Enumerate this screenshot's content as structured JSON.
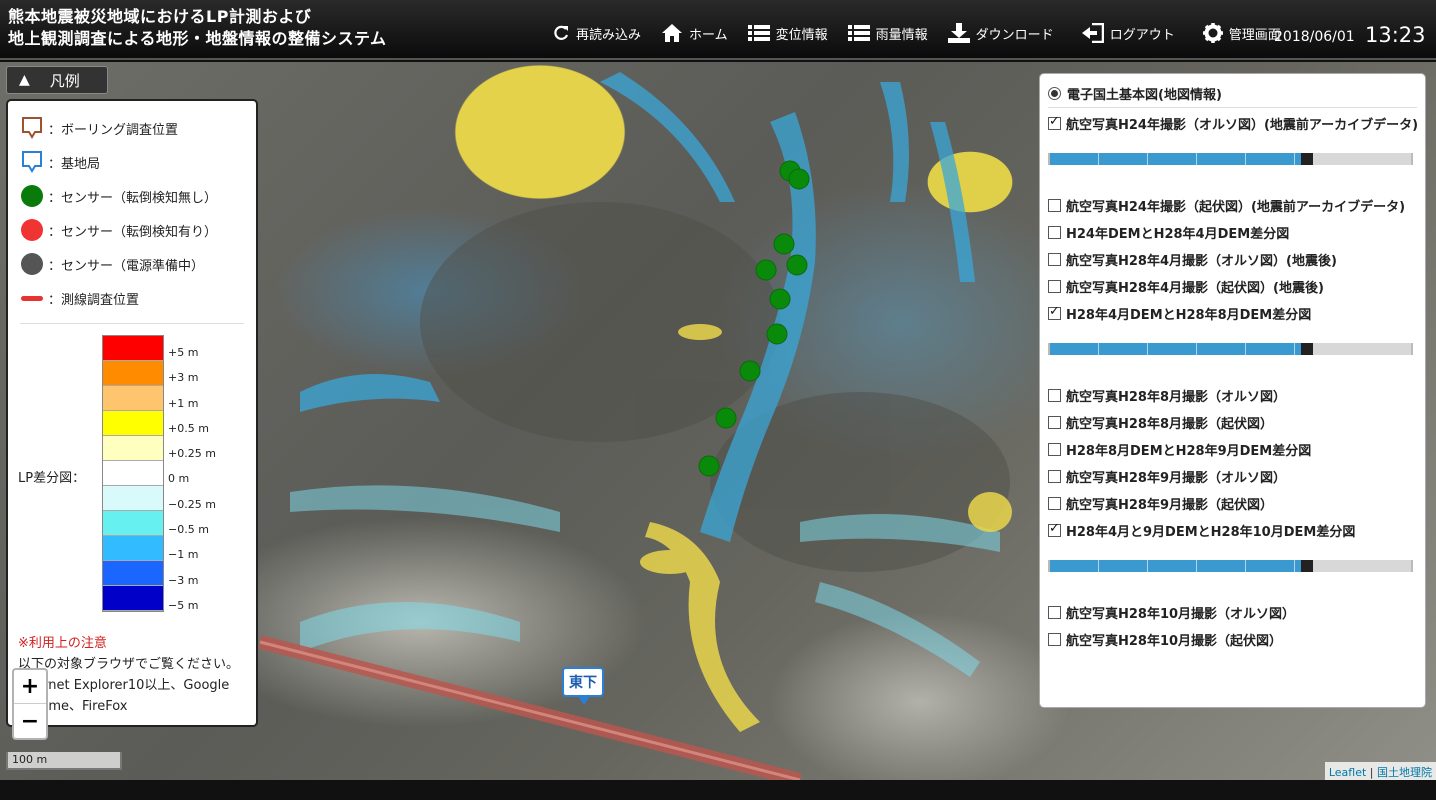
{
  "header": {
    "title_line1": "熊本地震被災地域におけるLP計測および",
    "title_line2": "地上観測調査による地形・地盤情報の整備システム",
    "nav": [
      {
        "label": "再読み込み",
        "icon": "refresh-icon"
      },
      {
        "label": "ホーム",
        "icon": "home-icon"
      },
      {
        "label": "変位情報",
        "icon": "list-icon"
      },
      {
        "label": "雨量情報",
        "icon": "list-icon"
      },
      {
        "label": "ダウンロード",
        "icon": "download-icon"
      },
      {
        "label": "ログアウト",
        "icon": "logout-icon"
      },
      {
        "label": "管理画面",
        "icon": "gear-icon"
      }
    ],
    "date": "2018/06/01",
    "time": "13:23"
  },
  "legend": {
    "toggle_label": "凡例",
    "items": [
      {
        "label": "：ボーリング調査位置",
        "symbol": "pin-brown",
        "color": "#a0522d"
      },
      {
        "label": "：基地局",
        "symbol": "pin-blue",
        "color": "#2a7fd6"
      },
      {
        "label": "：センサー（転倒検知無し）",
        "symbol": "dot",
        "color": "#0a7a0a"
      },
      {
        "label": "：センサー（転倒検知有り）",
        "symbol": "dot",
        "color": "#f03434"
      },
      {
        "label": "：センサー（電源準備中）",
        "symbol": "dot",
        "color": "#555555"
      },
      {
        "label": "：測線調査位置",
        "symbol": "line",
        "color": "#e83232"
      }
    ],
    "lp_label": "LP差分図：",
    "scale": [
      {
        "label": "+5 m",
        "color": "#ff0000"
      },
      {
        "label": "+3 m",
        "color": "#ff8c00"
      },
      {
        "label": "+1 m",
        "color": "#ffc46e"
      },
      {
        "label": "+0.5 m",
        "color": "#ffff00"
      },
      {
        "label": "+0.25 m",
        "color": "#ffffc0"
      },
      {
        "label": "0 m",
        "color": "#ffffff"
      },
      {
        "label": "−0.25 m",
        "color": "#d8fafa"
      },
      {
        "label": "−0.5 m",
        "color": "#66f0f0"
      },
      {
        "label": "−1 m",
        "color": "#33bbff"
      },
      {
        "label": "−3 m",
        "color": "#1a66ff"
      },
      {
        "label": "−5 m",
        "color": "#0000c8"
      }
    ],
    "note_title": "※利用上の注意",
    "note_lines": [
      "以下の対象ブラウザでご覧ください。",
      "Internet Explorer10以上、Google",
      "Chrome、FireFox"
    ]
  },
  "map": {
    "zoom_in": "+",
    "zoom_out": "−",
    "scale_label": "100 m",
    "station_label": "東下",
    "attribution_leaflet": "Leaflet",
    "attribution_sep": " | ",
    "attribution_gsi": "国土地理院"
  },
  "layers": {
    "base": "電子国土基本図(地図情報)",
    "groups": [
      {
        "items": [
          {
            "label": "航空写真H24年撮影（オルソ図）(地震前アーカイブデータ)",
            "checked": true
          }
        ],
        "opacity": 0.7
      },
      {
        "items": [
          {
            "label": "航空写真H24年撮影（起伏図）(地震前アーカイブデータ)",
            "checked": false
          },
          {
            "label": "H24年DEMとH28年4月DEM差分図",
            "checked": false
          },
          {
            "label": "航空写真H28年4月撮影（オルソ図）(地震後)",
            "checked": false
          },
          {
            "label": "航空写真H28年4月撮影（起伏図）(地震後)",
            "checked": false
          },
          {
            "label": "H28年4月DEMとH28年8月DEM差分図",
            "checked": true
          }
        ],
        "opacity": 0.7
      },
      {
        "items": [
          {
            "label": "航空写真H28年8月撮影（オルソ図）",
            "checked": false
          },
          {
            "label": "航空写真H28年8月撮影（起伏図）",
            "checked": false
          },
          {
            "label": "H28年8月DEMとH28年9月DEM差分図",
            "checked": false
          },
          {
            "label": "航空写真H28年9月撮影（オルソ図）",
            "checked": false
          },
          {
            "label": "航空写真H28年9月撮影（起伏図）",
            "checked": false
          },
          {
            "label": "H28年4月と9月DEMとH28年10月DEM差分図",
            "checked": true
          }
        ],
        "opacity": 0.7
      },
      {
        "items": [
          {
            "label": "航空写真H28年10月撮影（オルソ図）",
            "checked": false
          },
          {
            "label": "航空写真H28年10月撮影（起伏図）",
            "checked": false
          }
        ],
        "opacity": null
      }
    ]
  }
}
